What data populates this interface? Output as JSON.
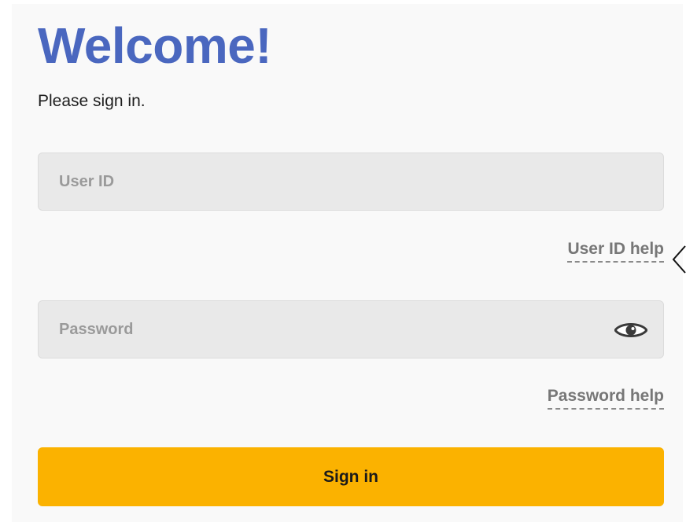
{
  "header": {
    "title": "Welcome!",
    "subtitle": "Please sign in."
  },
  "form": {
    "user_id": {
      "value": "",
      "placeholder": "User ID",
      "help_link": "User ID help"
    },
    "password": {
      "value": "",
      "placeholder": "Password",
      "toggle_icon": "eye-icon",
      "help_link": "Password help"
    },
    "submit_label": "Sign in"
  },
  "colors": {
    "title": "#4a67bf",
    "button": "#fbb200",
    "panel": "#f9f9f9",
    "field": "#e9e9e9"
  }
}
